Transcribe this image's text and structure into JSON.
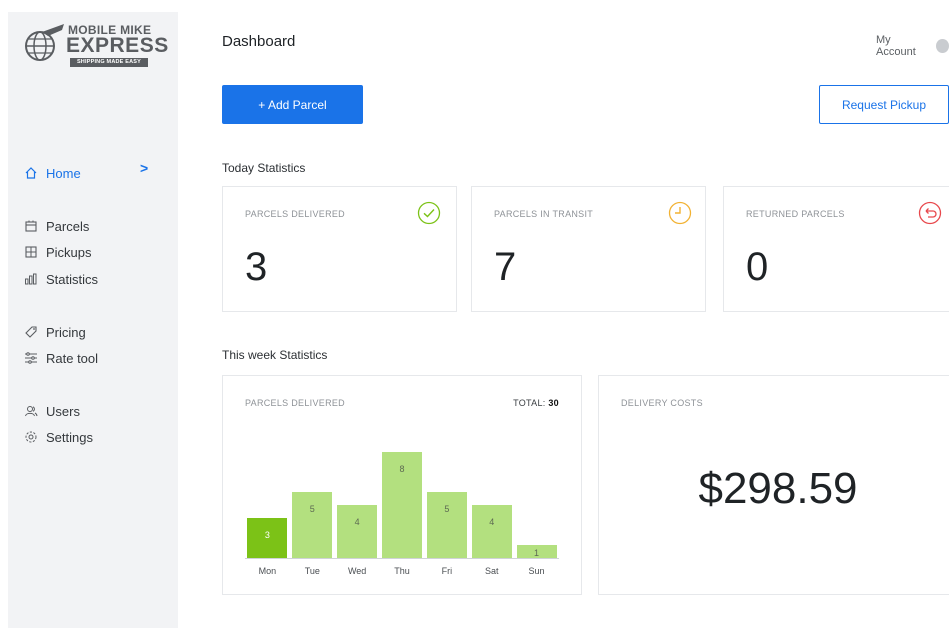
{
  "logo": {
    "line1": "MOBILE MIKE",
    "line2": "EXPRESS",
    "line3": "SHIPPING MADE EASY"
  },
  "sidebar": {
    "items": [
      {
        "label": "Home",
        "icon": "home-icon",
        "active": true
      },
      {
        "label": "Parcels",
        "icon": "parcel-icon"
      },
      {
        "label": "Pickups",
        "icon": "pickup-icon"
      },
      {
        "label": "Statistics",
        "icon": "statistics-icon"
      },
      {
        "label": "Pricing",
        "icon": "tag-icon"
      },
      {
        "label": "Rate tool",
        "icon": "sliders-icon"
      },
      {
        "label": "Users",
        "icon": "users-icon"
      },
      {
        "label": "Settings",
        "icon": "gear-icon"
      }
    ],
    "active_chevron": ">"
  },
  "header": {
    "title": "Dashboard",
    "account_label": "My Account"
  },
  "actions": {
    "add_parcel": "+ Add Parcel",
    "request_pickup": "Request Pickup"
  },
  "today": {
    "title": "Today Statistics",
    "cards": [
      {
        "label": "PARCELS DELIVERED",
        "value": "3",
        "icon": "check-circle-icon",
        "color": "#7cc217"
      },
      {
        "label": "PARCELS IN TRANSIT",
        "value": "7",
        "icon": "clock-icon",
        "color": "#f2b233"
      },
      {
        "label": "RETURNED PARCELS",
        "value": "0",
        "icon": "return-icon",
        "color": "#e8484c"
      }
    ]
  },
  "week": {
    "title": "This week Statistics",
    "delivered_card": {
      "label": "PARCELS DELIVERED",
      "total_label": "TOTAL:",
      "total_value": "30"
    },
    "costs_card": {
      "label": "DELIVERY COSTS",
      "value": "$298.59"
    }
  },
  "chart_data": {
    "type": "bar",
    "categories": [
      "Mon",
      "Tue",
      "Wed",
      "Thu",
      "Fri",
      "Sat",
      "Sun"
    ],
    "values": [
      3,
      5,
      4,
      8,
      5,
      4,
      1
    ],
    "highlight_index": 0,
    "ylim": [
      0,
      8
    ],
    "colors": {
      "highlight": "#7cc217",
      "default": "#b3e07f"
    }
  },
  "colors": {
    "accent": "#1a73e8",
    "sidebar_bg": "#f2f3f5"
  }
}
